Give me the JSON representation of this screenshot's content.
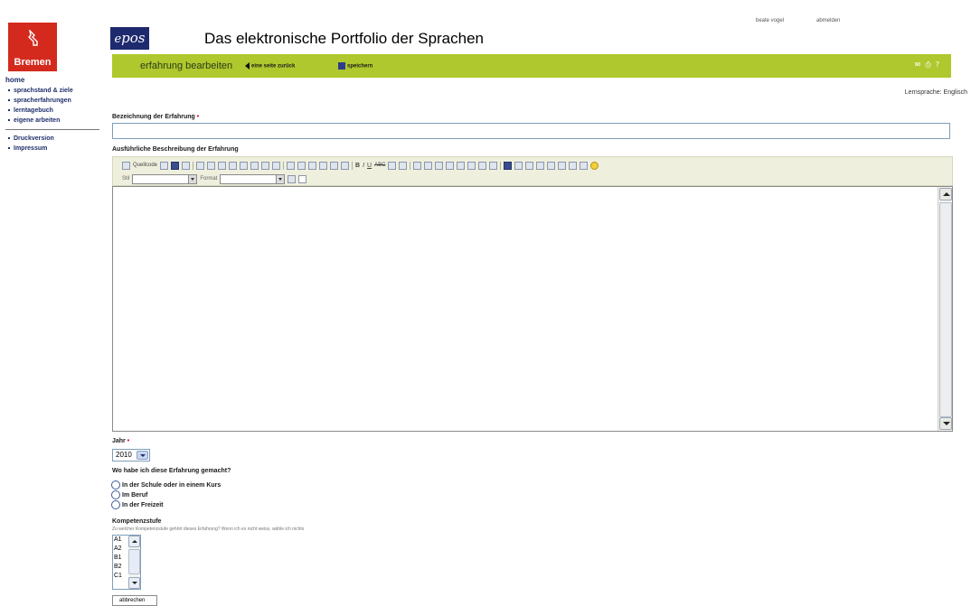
{
  "brand": {
    "city": "Bremen",
    "logo_text": "pos"
  },
  "header": {
    "title": "Das elektronische Portfolio der Sprachen",
    "user": "beate vogel",
    "logout": "abmelden"
  },
  "nav": {
    "home": "home",
    "items": [
      "sprachstand & ziele",
      "spracherfahrungen",
      "lerntagebuch",
      "eigene arbeiten"
    ],
    "bottom_items": [
      "Druckversion",
      "Impressum"
    ]
  },
  "actionbar": {
    "title": "erfahrung bearbeiten",
    "back": "eine seite zurück",
    "save": "speichern"
  },
  "lernsprache": "Lernsprache: Englisch",
  "form": {
    "title_label": "Bezeichnung der Erfahrung",
    "title_value": "",
    "desc_label": "Ausführliche Beschreibung der Erfahrung",
    "toolbar": {
      "source_label": "Quellcode",
      "style_label": "Stil",
      "format_label": "Format"
    },
    "year_label": "Jahr",
    "year_value": "2010",
    "where_label": "Wo habe ich diese Erfahrung gemacht?",
    "where_options": [
      "In der Schule oder in einem Kurs",
      "Im Beruf",
      "In der Freizeit"
    ],
    "level_label": "Kompetenzstufe",
    "level_hint": "Zu welcher Kompetenzstufe gehört dieses Erfahrung? Wenn ich es nicht weiss, wähle ich nichts",
    "level_options": [
      "A1",
      "A2",
      "B1",
      "B2",
      "C1"
    ],
    "cancel": "abbrechen"
  },
  "colors": {
    "brand_red": "#d42a1e",
    "accent_green": "#afc82d",
    "nav_blue": "#1f2f6b",
    "required": "#e0001a"
  }
}
